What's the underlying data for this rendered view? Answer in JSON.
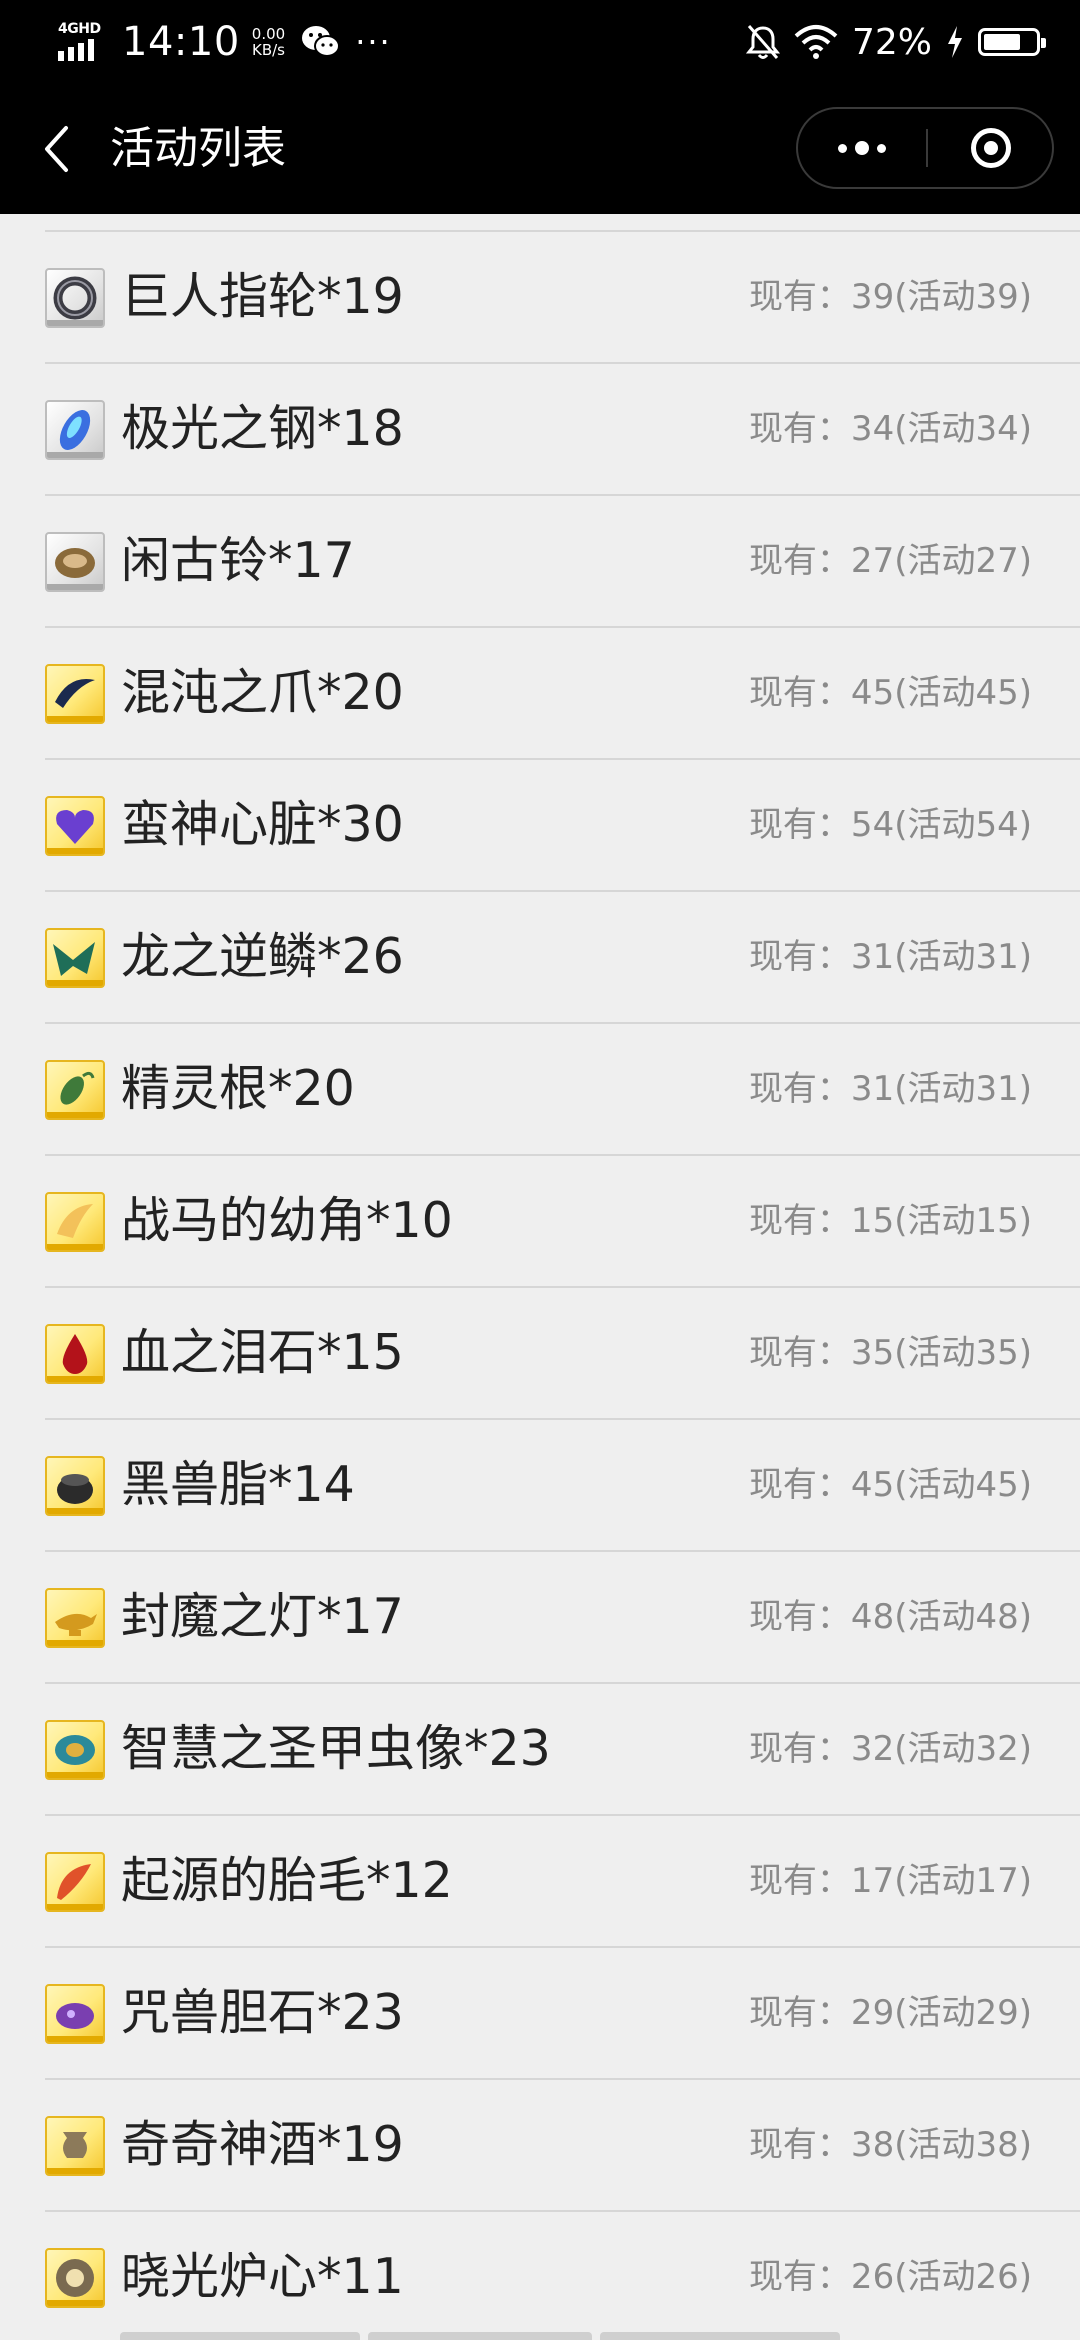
{
  "status_bar": {
    "network": "4GHD",
    "time": "14:10",
    "speed_value": "0.00",
    "speed_unit": "KB/s",
    "more": "···",
    "battery_text": "72%",
    "battery_level": 0.72
  },
  "nav": {
    "title": "活动列表"
  },
  "items": [
    {
      "name": "巨人指轮*19",
      "stock": "现有：39(活动39)",
      "frame": "silver",
      "icon": "ring-icon",
      "color": "#3c3c44"
    },
    {
      "name": "极光之钢*18",
      "stock": "现有：34(活动34)",
      "frame": "silver",
      "icon": "aurora-steel-icon",
      "color": "#3a6fe0"
    },
    {
      "name": "闲古铃*17",
      "stock": "现有：27(活动27)",
      "frame": "silver",
      "icon": "bell-icon",
      "color": "#8a6a3a"
    },
    {
      "name": "混沌之爪*20",
      "stock": "现有：45(活动45)",
      "frame": "gold",
      "icon": "claw-icon",
      "color": "#1b2a4e"
    },
    {
      "name": "蛮神心脏*30",
      "stock": "现有：54(活动54)",
      "frame": "gold",
      "icon": "heart-icon",
      "color": "#6a3fd0"
    },
    {
      "name": "龙之逆鳞*26",
      "stock": "现有：31(活动31)",
      "frame": "gold",
      "icon": "dragon-scale-icon",
      "color": "#1f6e58"
    },
    {
      "name": "精灵根*20",
      "stock": "现有：31(活动31)",
      "frame": "gold",
      "icon": "spirit-root-icon",
      "color": "#3f7a3a"
    },
    {
      "name": "战马的幼角*10",
      "stock": "现有：15(活动15)",
      "frame": "gold",
      "icon": "horn-icon",
      "color": "#f3c15a"
    },
    {
      "name": "血之泪石*15",
      "stock": "现有：35(活动35)",
      "frame": "gold",
      "icon": "blood-tear-icon",
      "color": "#b3121a"
    },
    {
      "name": "黑兽脂*14",
      "stock": "现有：45(活动45)",
      "frame": "gold",
      "icon": "black-fat-icon",
      "color": "#2b2b2b"
    },
    {
      "name": "封魔之灯*17",
      "stock": "现有：48(活动48)",
      "frame": "gold",
      "icon": "lamp-icon",
      "color": "#d49a1e"
    },
    {
      "name": "智慧之圣甲虫像*23",
      "stock": "现有：32(活动32)",
      "frame": "gold",
      "icon": "scarab-icon",
      "color": "#2b8a9a"
    },
    {
      "name": "起源的胎毛*12",
      "stock": "现有：17(活动17)",
      "frame": "gold",
      "icon": "feather-icon",
      "color": "#e0522a"
    },
    {
      "name": "咒兽胆石*23",
      "stock": "现有：29(活动29)",
      "frame": "gold",
      "icon": "gallstone-icon",
      "color": "#7a3fb0"
    },
    {
      "name": "奇奇神酒*19",
      "stock": "现有：38(活动38)",
      "frame": "gold",
      "icon": "wine-vessel-icon",
      "color": "#8c7a5a"
    },
    {
      "name": "晓光炉心*11",
      "stock": "现有：26(活动26)",
      "frame": "gold",
      "icon": "furnace-core-icon",
      "color": "#7a6a50"
    }
  ]
}
